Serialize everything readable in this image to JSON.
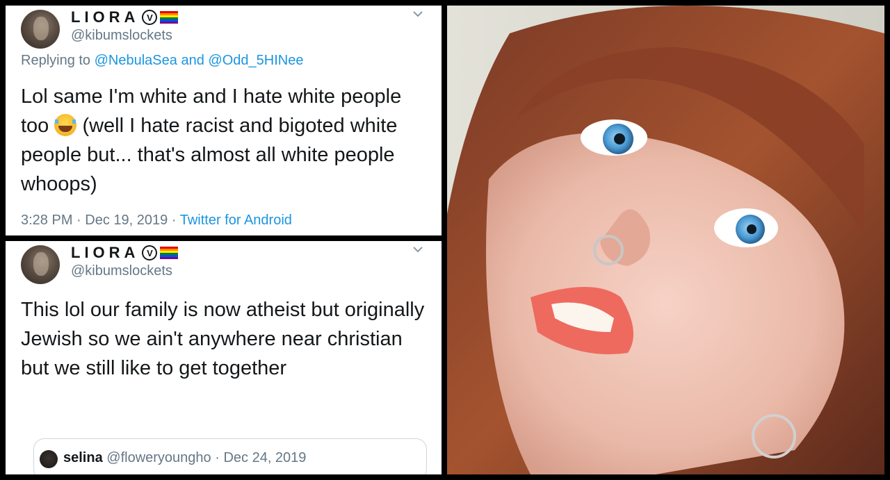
{
  "tweet1": {
    "display_name": "LIORA",
    "verified_glyph": "V",
    "handle": "@kibumslockets",
    "reply_prefix": "Replying to",
    "reply_user1": "@NebulaSea",
    "reply_and": "and",
    "reply_user2": "@Odd_5HINee",
    "body_part1": "Lol same I'm white and I hate white people too",
    "emoji": "face-with-tears-of-joy-icon",
    "body_part2": "(well I hate racist and bigoted white people but... that's almost all white people whoops)",
    "time": "3:28 PM",
    "sep": "·",
    "date": "Dec 19, 2019",
    "source": "Twitter for Android"
  },
  "tweet2": {
    "display_name": "LIORA",
    "verified_glyph": "V",
    "handle": "@kibumslockets",
    "body": "This lol our family is now atheist but originally Jewish so we ain't anywhere near christian but we still like to get together",
    "quote": {
      "name": "selina",
      "handle": "@floweryoungho",
      "sep": "·",
      "date": "Dec 24, 2019"
    }
  },
  "colors": {
    "text": "#14171a",
    "secondary": "#657786",
    "link": "#1b95e0",
    "rainbow": [
      "#e40303",
      "#ff8c00",
      "#ffed00",
      "#008026",
      "#004dff",
      "#750787"
    ]
  },
  "icons": {
    "menu": "chevron-down-icon",
    "verified": "verified-badge-icon",
    "flag": "rainbow-flag-icon"
  }
}
